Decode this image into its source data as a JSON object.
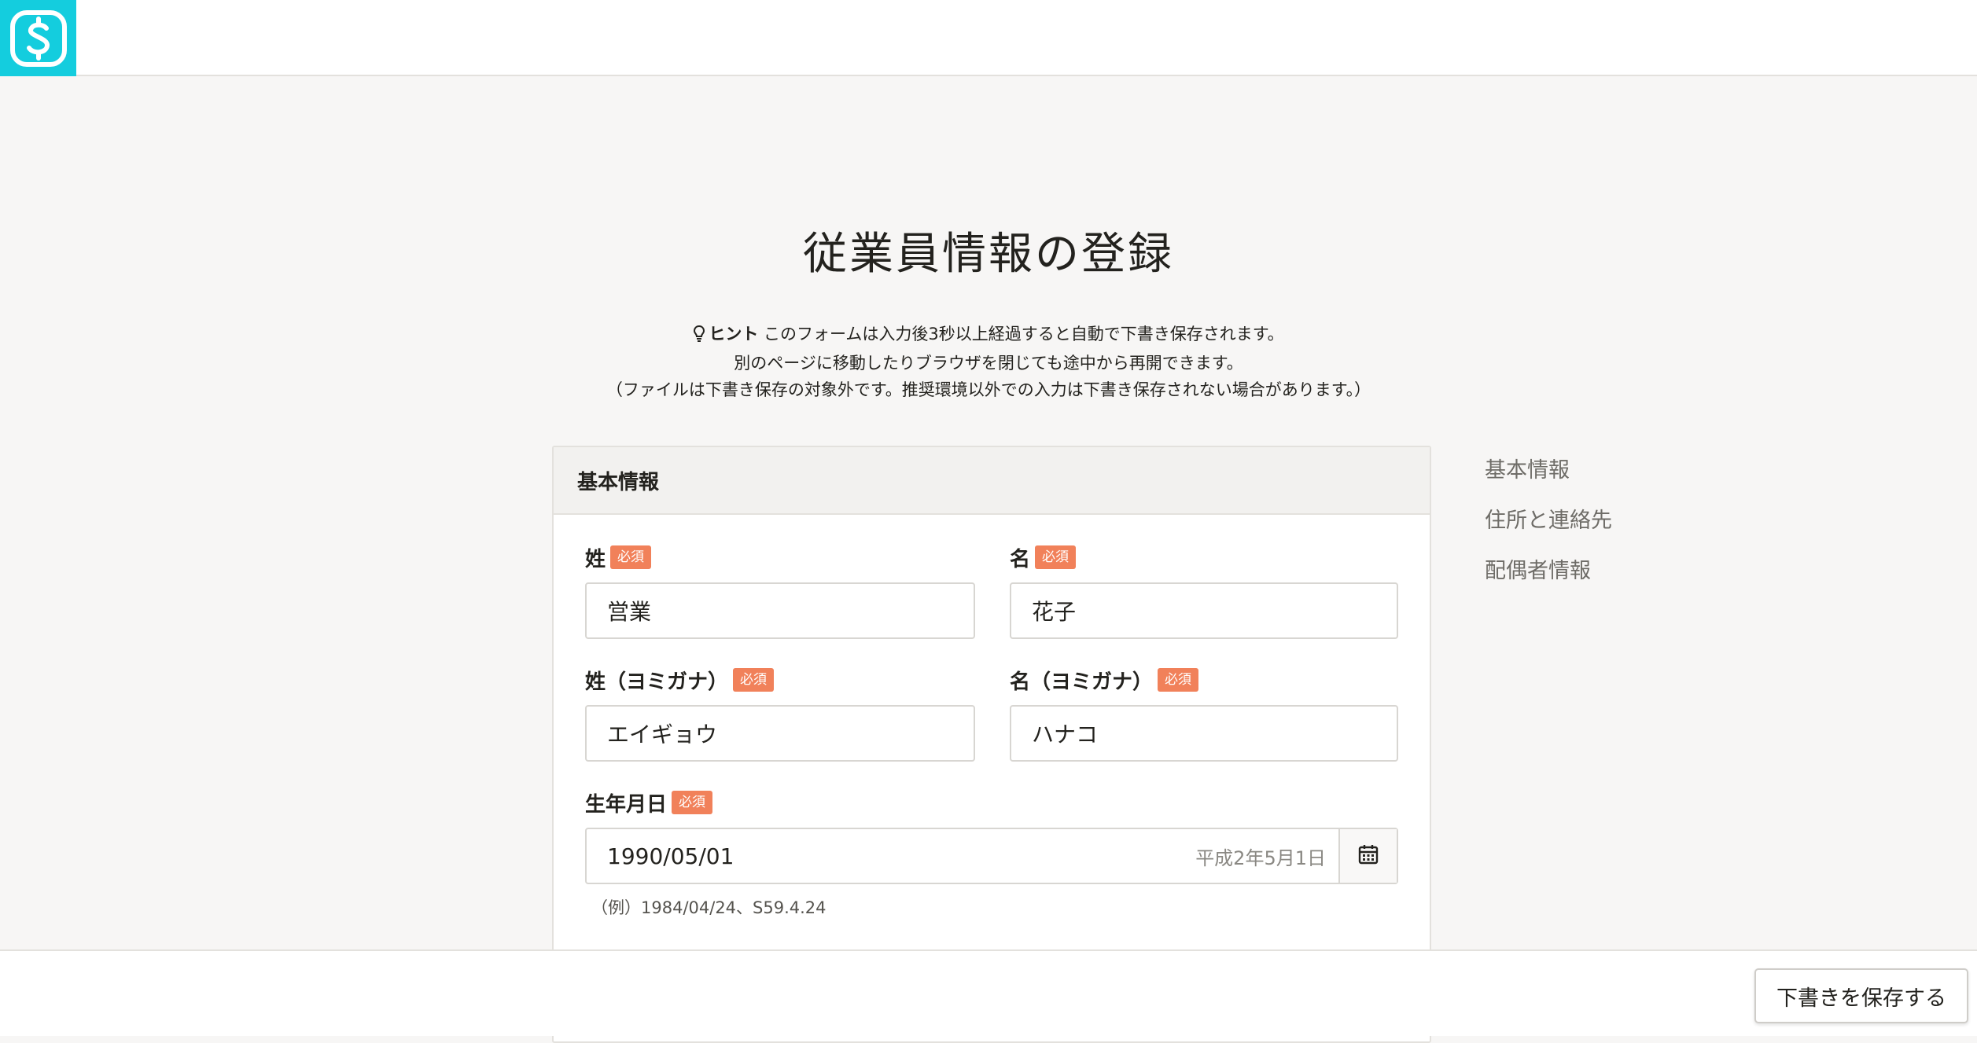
{
  "header": {
    "logo_icon": "smarthr-logo-icon",
    "logo_bg": "#14cdde"
  },
  "page": {
    "title": "従業員情報の登録"
  },
  "hint": {
    "label": "ヒント",
    "line1": "このフォームは入力後3秒以上経過すると自動で下書き保存されます。",
    "line2": "別のページに移動したりブラウザを閉じても途中から再開できます。",
    "line3": "（ファイルは下書き保存の対象外です。推奨環境以外での入力は下書き保存されない場合があります。）"
  },
  "section": {
    "title": "基本情報",
    "required_label": "必須",
    "last_name": {
      "label": "姓",
      "value": "営業"
    },
    "first_name": {
      "label": "名",
      "value": "花子"
    },
    "last_name_kana": {
      "label": "姓（ヨミガナ）",
      "value": "エイギョウ"
    },
    "first_name_kana": {
      "label": "名（ヨミガナ）",
      "value": "ハナコ"
    },
    "birthday": {
      "label": "生年月日",
      "value": "1990/05/01",
      "era": "平成2年5月1日",
      "example": "（例）1984/04/24、S59.4.24"
    }
  },
  "side_nav": {
    "items": [
      "基本情報",
      "住所と連絡先",
      "配偶者情報"
    ]
  },
  "footer": {
    "save_draft": "下書きを保存する"
  },
  "colors": {
    "required_badge": "#f1815a",
    "accent": "#14cdde"
  }
}
